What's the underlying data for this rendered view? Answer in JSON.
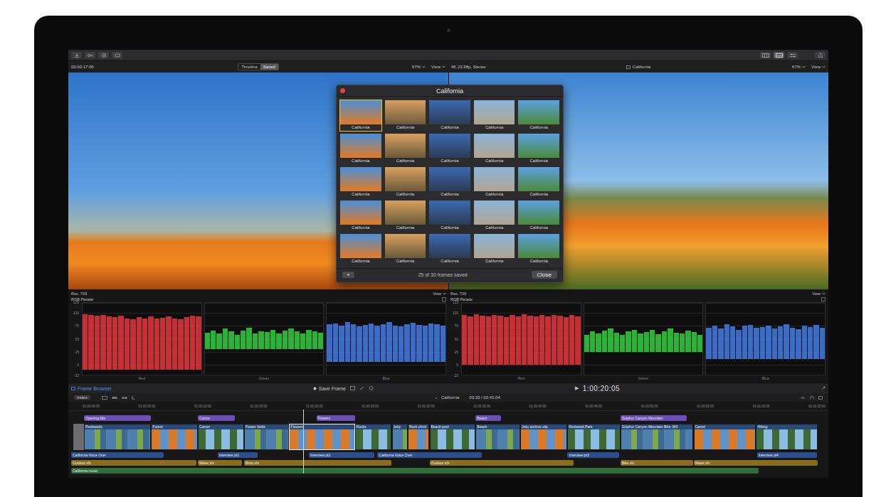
{
  "viewer_bar": {
    "timecode": "00:00:17:06",
    "segments": [
      {
        "label": "Timeline",
        "selected": false
      },
      {
        "label": "Saved",
        "selected": true
      }
    ],
    "zoom_left": "67%",
    "view_left": "View",
    "format": "4K 23.98p, Stereo",
    "clip": "California",
    "zoom_right": "67%",
    "view_right": "View"
  },
  "frame_dialog": {
    "title": "California",
    "frames": [
      {
        "label": "California",
        "selected": true
      },
      {
        "label": "California",
        "selected": false
      },
      {
        "label": "California",
        "selected": false
      },
      {
        "label": "California",
        "selected": false
      },
      {
        "label": "California",
        "selected": false
      },
      {
        "label": "California",
        "selected": false
      },
      {
        "label": "California",
        "selected": false
      },
      {
        "label": "California",
        "selected": false
      },
      {
        "label": "California",
        "selected": false
      },
      {
        "label": "California",
        "selected": false
      },
      {
        "label": "California",
        "selected": false
      },
      {
        "label": "California",
        "selected": false
      },
      {
        "label": "California",
        "selected": false
      },
      {
        "label": "California",
        "selected": false
      },
      {
        "label": "California",
        "selected": false
      },
      {
        "label": "California",
        "selected": false
      },
      {
        "label": "California",
        "selected": false
      },
      {
        "label": "California",
        "selected": false
      },
      {
        "label": "California",
        "selected": false
      },
      {
        "label": "California",
        "selected": false
      },
      {
        "label": "California",
        "selected": false
      },
      {
        "label": "California",
        "selected": false
      },
      {
        "label": "California",
        "selected": false
      },
      {
        "label": "California",
        "selected": false
      },
      {
        "label": "California",
        "selected": false
      }
    ],
    "add_button": "+",
    "status": "25 of 30 frames saved",
    "close_button": "Close"
  },
  "scopes": [
    {
      "standard": "Rec. 709",
      "view": "View",
      "title": "RGB Parade",
      "ticks": [
        "120",
        "100",
        "75",
        "50",
        "25",
        "0",
        "-20"
      ],
      "channels": [
        {
          "label": "Red",
          "color": "#e8353b",
          "floor": -10,
          "values": [
            98,
            96,
            95,
            97,
            94,
            92,
            95,
            90,
            88,
            92,
            90,
            93,
            89,
            91,
            94,
            90,
            88,
            92,
            95,
            93
          ]
        },
        {
          "label": "Green",
          "color": "#2fd13a",
          "floor": 30,
          "values": [
            62,
            66,
            60,
            70,
            64,
            58,
            66,
            72,
            60,
            65,
            63,
            68,
            61,
            66,
            70,
            64,
            60,
            67,
            65,
            62
          ]
        },
        {
          "label": "Blue",
          "color": "#3f7de8",
          "floor": 5,
          "values": [
            78,
            80,
            76,
            82,
            79,
            74,
            77,
            80,
            75,
            78,
            83,
            76,
            74,
            79,
            81,
            77,
            75,
            80,
            78,
            76
          ]
        }
      ]
    },
    {
      "standard": "Rec. 709",
      "view": "View",
      "title": "RGB Parade",
      "ticks": [
        "120",
        "100",
        "75",
        "50",
        "25",
        "0",
        "-20"
      ],
      "channels": [
        {
          "label": "Red",
          "color": "#e8353b",
          "floor": 0,
          "values": [
            96,
            94,
            98,
            95,
            93,
            97,
            95,
            92,
            96,
            94,
            98,
            95,
            93,
            96,
            94,
            97,
            95,
            92,
            96,
            94
          ]
        },
        {
          "label": "Green",
          "color": "#2fd13a",
          "floor": 25,
          "values": [
            58,
            64,
            60,
            66,
            70,
            62,
            58,
            65,
            68,
            60,
            63,
            67,
            59,
            64,
            70,
            62,
            60,
            66,
            63,
            58
          ]
        },
        {
          "label": "Blue",
          "color": "#3f7de8",
          "floor": 10,
          "values": [
            72,
            76,
            70,
            78,
            74,
            68,
            75,
            77,
            71,
            73,
            76,
            70,
            74,
            78,
            72,
            69,
            75,
            73,
            77,
            71
          ]
        }
      ]
    }
  ],
  "timeline_header": {
    "browser": "Frame Browser",
    "save": "Save Frame",
    "play": "▶",
    "timecode": "1:00:20:05"
  },
  "index_bar": {
    "index": "Index",
    "back": "‹",
    "project": "California",
    "duration": "00:20 / 02:41:04"
  },
  "ruler": [
    "01:00:00:00",
    "01:00:05:00",
    "01:00:10:00",
    "01:00:15:00",
    "01:00:20:00",
    "01:00:25:00",
    "01:00:30:00",
    "01:00:35:00",
    "01:00:40:00",
    "01:00:45:00",
    "01:00:50:00",
    "01:00:55:00",
    "01:01:00:00",
    "01:01:05:00"
  ],
  "playhead": 30.8,
  "titles": [
    {
      "label": "Opening title",
      "start": 1.7,
      "end": 10.6
    },
    {
      "label": "Canoe",
      "start": 16.8,
      "end": 21.7
    },
    {
      "label": "Flowers",
      "start": 32.5,
      "end": 37.6
    },
    {
      "label": "Beach",
      "start": 53.6,
      "end": 57.0
    },
    {
      "label": "Sulphur Canyon Mountain",
      "start": 72.8,
      "end": 81.6
    }
  ],
  "clips": [
    {
      "label": "Redwoods",
      "start": 1.7,
      "end": 10.6,
      "selected": false
    },
    {
      "label": "Forest",
      "start": 10.6,
      "end": 16.8,
      "selected": false
    },
    {
      "label": "Canoe",
      "start": 16.8,
      "end": 22.9,
      "selected": false
    },
    {
      "label": "Flower fields",
      "start": 22.9,
      "end": 28.9,
      "selected": false
    },
    {
      "label": "Flowers",
      "start": 28.9,
      "end": 37.6,
      "selected": true
    },
    {
      "label": "Rocks",
      "start": 37.6,
      "end": 42.5,
      "selected": false
    },
    {
      "label": "Jetty",
      "start": 42.5,
      "end": 44.6,
      "selected": false
    },
    {
      "label": "Rock climb",
      "start": 44.6,
      "end": 47.5,
      "selected": false
    },
    {
      "label": "Beach pool",
      "start": 47.5,
      "end": 53.6,
      "selected": false
    },
    {
      "label": "Beach",
      "start": 53.6,
      "end": 59.5,
      "selected": false
    },
    {
      "label": "Jetty archive clip",
      "start": 59.5,
      "end": 65.8,
      "selected": false
    },
    {
      "label": "Redwood Park",
      "start": 65.8,
      "end": 72.8,
      "selected": false
    },
    {
      "label": "Sulphur Canyon Mountain Bike 360",
      "start": 72.8,
      "end": 82.5,
      "selected": false
    },
    {
      "label": "Camel",
      "start": 82.5,
      "end": 90.8,
      "selected": false
    },
    {
      "label": "Hiking",
      "start": 90.8,
      "end": 99.0,
      "selected": false
    }
  ],
  "audio_lanes": [
    {
      "color": "#2c4f8c",
      "items": [
        {
          "label": "California Voice Over",
          "start": 0,
          "end": 12.3
        },
        {
          "label": "Interview pt1",
          "start": 19.4,
          "end": 24.7
        },
        {
          "label": "Interview pt2",
          "start": 31.5,
          "end": 40.2
        },
        {
          "label": "California Voice Over",
          "start": 40.6,
          "end": 54.4
        },
        {
          "label": "Interview pt3",
          "start": 65.8,
          "end": 72.6
        },
        {
          "label": "Interview pt4",
          "start": 90.9,
          "end": 98.9
        }
      ]
    },
    {
      "color": "#8a6d1c",
      "items": [
        {
          "label": "Outdoor sfx",
          "start": 0,
          "end": 16.6
        },
        {
          "label": "Water sfx",
          "start": 16.8,
          "end": 22.6
        },
        {
          "label": "Birds sfx",
          "start": 22.9,
          "end": 42.5
        },
        {
          "label": "Outdoor sfx",
          "start": 47.5,
          "end": 66.6
        },
        {
          "label": "Bike sfx",
          "start": 72.8,
          "end": 82.5
        },
        {
          "label": "Water sfx",
          "start": 82.5,
          "end": 99.0
        }
      ]
    },
    {
      "color": "#2f6e3a",
      "items": [
        {
          "label": "California music",
          "start": 0,
          "end": 91.1
        }
      ]
    }
  ]
}
